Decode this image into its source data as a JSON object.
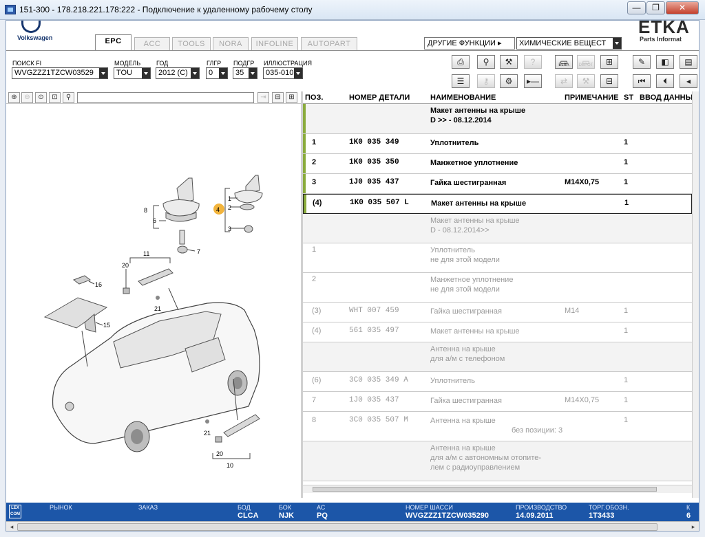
{
  "window": {
    "title": "151-300 - 178.218.221.178:222 - Подключение к удаленному рабочему столу",
    "minimize": "—",
    "restore": "❐",
    "close": "✕"
  },
  "brand": {
    "vw_text": "Volkswagen",
    "etka_text": "ETKA",
    "etka_sub": "Parts Informat"
  },
  "tabs": [
    {
      "label": "EPC"
    },
    {
      "label": "ACC"
    },
    {
      "label": "TOOLS"
    },
    {
      "label": "NORA"
    },
    {
      "label": "INFOLINE"
    },
    {
      "label": "AUTOPART"
    }
  ],
  "other_functions": {
    "label": "ДРУГИЕ ФУНКЦИИ ▸",
    "selected": "ХИМИЧЕСКИЕ ВЕЩЕСТ"
  },
  "filters": {
    "fi_label": "ПОИСК FI",
    "fi_value": "WVGZZZ1TZCW03529",
    "model_label": "МОДЕЛЬ",
    "model_value": "TOU",
    "year_label": "ГОД",
    "year_value": "2012 (C)",
    "mg_label": "ГЛГР",
    "mg_value": "0",
    "sg_label": "ПОДГР",
    "sg_value": "35",
    "ill_label": "ИЛЛЮСТРАЦИЯ",
    "ill_value": "035-010"
  },
  "toolbar": {
    "elsa": "ELSA",
    "depot": "DEPOT"
  },
  "illustration": {
    "callouts": [
      "8",
      "6",
      "7",
      "4",
      "1",
      "2",
      "3",
      "11",
      "20",
      "16",
      "21",
      "15",
      "21",
      "20",
      "10"
    ]
  },
  "grid": {
    "headers": {
      "pos": "ПОЗ.",
      "part": "НОМЕР ДЕТАЛИ",
      "name": "НАИМЕНОВАНИЕ",
      "note": "ПРИМЕЧАНИЕ",
      "st": "ST",
      "input": "ВВОД ДАННЫХ"
    },
    "rows": [
      {
        "pos": "",
        "part": "",
        "name": "Макет антенны на крыше",
        "name2": "D             >> - 08.12.2014",
        "note": "",
        "st": ""
      },
      {
        "pos": "1",
        "part": "1K0  035  349",
        "name": "Уплотнитель",
        "name2": "",
        "note": "",
        "st": "1"
      },
      {
        "pos": "2",
        "part": "1K0  035  350",
        "name": "Манжетное уплотнение",
        "name2": "",
        "note": "",
        "st": "1"
      },
      {
        "pos": "3",
        "part": "1J0  035  437",
        "name": "Гайка шестигранная",
        "name2": "",
        "note": "M14X0,75",
        "st": "1"
      },
      {
        "pos": "(4)",
        "part": "1K0  035  507  L",
        "name": "Макет антенны на крыше",
        "name2": "",
        "note": "",
        "st": "1"
      },
      {
        "pos": "",
        "part": "",
        "name": "Макет антенны на крыше",
        "name2": "D - 08.12.2014>>",
        "note": "",
        "st": ""
      },
      {
        "pos": "1",
        "part": "",
        "name": "Уплотнитель",
        "name2": "не для этой модели",
        "note": "",
        "st": ""
      },
      {
        "pos": "2",
        "part": "",
        "name": "Манжетное уплотнение",
        "name2": "не для этой модели",
        "note": "",
        "st": ""
      },
      {
        "pos": "(3)",
        "part": "WHT  007  459",
        "name": "Гайка шестигранная",
        "name2": "",
        "note": "M14",
        "st": "1"
      },
      {
        "pos": "(4)",
        "part": "561  035  497",
        "name": "Макет антенны на крыше",
        "name2": "",
        "note": "",
        "st": "1"
      },
      {
        "pos": "",
        "part": "",
        "name": "Антенна на крыше",
        "name2": "для а/м с телефоном",
        "note": "",
        "st": ""
      },
      {
        "pos": "(6)",
        "part": "3C0  035  349  A",
        "name": "Уплотнитель",
        "name2": "",
        "note": "",
        "st": "1"
      },
      {
        "pos": "7",
        "part": "1J0  035  437",
        "name": "Гайка шестигранная",
        "name2": "",
        "note": "M14X0,75",
        "st": "1"
      },
      {
        "pos": "8",
        "part": "3C0  035  507  M",
        "name": "Антенна на крыше",
        "name2": "",
        "note": "",
        "st": "1",
        "extra": "без позиции:   3"
      },
      {
        "pos": "",
        "part": "",
        "name": "Антенна на крыше",
        "name2": "для а/м с автономным отопите-",
        "name3": "лем с радиоуправлением",
        "note": "",
        "st": ""
      }
    ]
  },
  "status": {
    "market_label": "РЫНОК",
    "order_label": "ЗАКАЗ",
    "bod_label": "БОД",
    "bod_value": "CLCA",
    "bok_label": "БОК",
    "bok_value": "NJK",
    "ac_label": "АС",
    "ac_value": "PQ",
    "chassis_label": "НОМЕР ШАССИ",
    "chassis_value": "WVGZZZ1TZCW035290",
    "prod_label": "ПРОИЗВОДСТВО",
    "prod_value": "14.09.2011",
    "torg_label": "ТОРГ.ОБОЗН.",
    "torg_value": "1T3433",
    "last_label": "К",
    "last_value": "6"
  },
  "colors": {
    "statusbar": "#1c56a8",
    "row_accent": "#8aab3c",
    "callout_highlight": "#f2b43c"
  }
}
